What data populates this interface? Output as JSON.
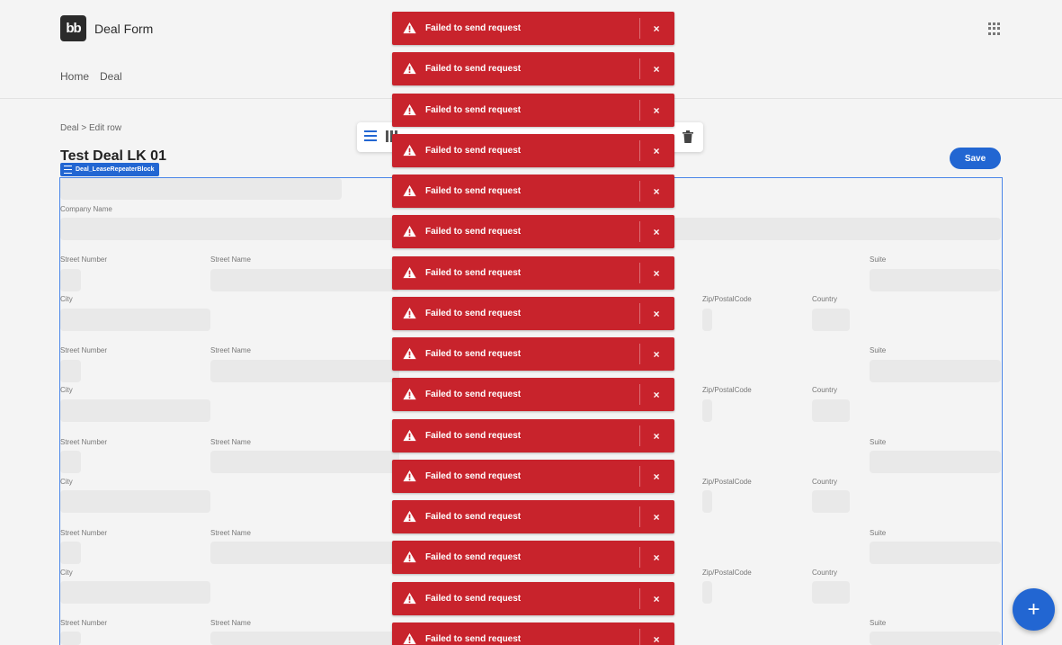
{
  "app": {
    "logo_text": "bb",
    "title": "Deal Form"
  },
  "nav": {
    "items": [
      "Home",
      "Deal"
    ]
  },
  "breadcrumb": "Deal > Edit row",
  "page_title": "Test Deal LK 01",
  "save_label": "Save",
  "block_tag": "Deal_LeaseRepeaterBlock",
  "form": {
    "company_name_label": "Company Name",
    "street_number_label": "Street Number",
    "street_name_label": "Street Name",
    "suite_label": "Suite",
    "city_label": "City",
    "zip_label": "Zip/PostalCode",
    "country_label": "Country"
  },
  "toasts": [
    "Failed to send request",
    "Failed to send request",
    "Failed to send request",
    "Failed to send request",
    "Failed to send request",
    "Failed to send request",
    "Failed to send request",
    "Failed to send request",
    "Failed to send request",
    "Failed to send request",
    "Failed to send request",
    "Failed to send request",
    "Failed to send request",
    "Failed to send request",
    "Failed to send request",
    "Failed to send request"
  ],
  "toast_close": "×",
  "fab_label": "+",
  "colors": {
    "accent": "#2266d2",
    "error": "#c8232c"
  }
}
